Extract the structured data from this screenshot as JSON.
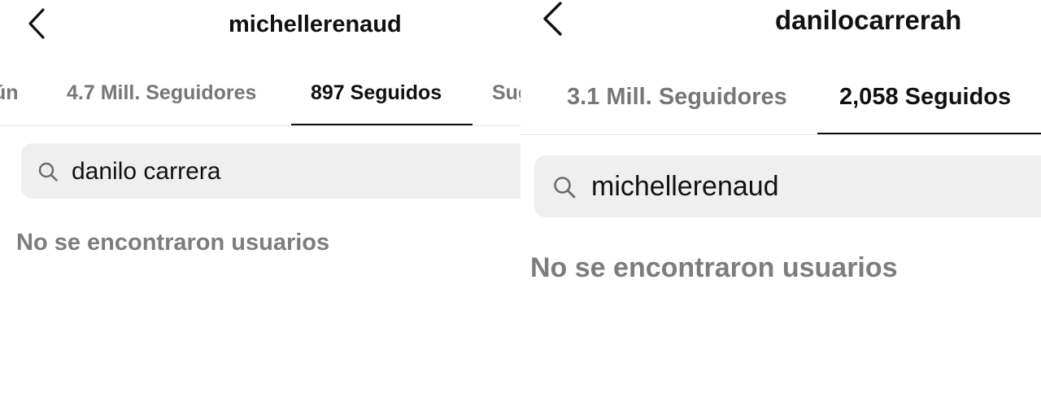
{
  "left_screen": {
    "header": {
      "back_icon": "chevron-left-icon",
      "username": "michellerenaud"
    },
    "tabs": [
      {
        "label": "ún",
        "active": false
      },
      {
        "label": "4.7 Mill. Seguidores",
        "active": false
      },
      {
        "label": "897 Seguidos",
        "active": true
      },
      {
        "label": "Sug",
        "active": false
      }
    ],
    "search": {
      "icon": "search-icon",
      "value": "danilo carrera"
    },
    "empty_message": "No se encontraron usuarios"
  },
  "right_screen": {
    "header": {
      "back_icon": "chevron-left-icon",
      "username": "danilocarrerah"
    },
    "tabs": [
      {
        "label": "3.1 Mill. Seguidores",
        "active": false
      },
      {
        "label": "2,058 Seguidos",
        "active": true
      }
    ],
    "search": {
      "icon": "search-icon",
      "value": "michellerenaud"
    },
    "empty_message": "No se encontraron usuarios"
  },
  "colors": {
    "text_primary": "#111111",
    "text_muted": "#777777",
    "search_background": "#efefef",
    "divider": "#e3e3e3",
    "background": "#ffffff"
  }
}
